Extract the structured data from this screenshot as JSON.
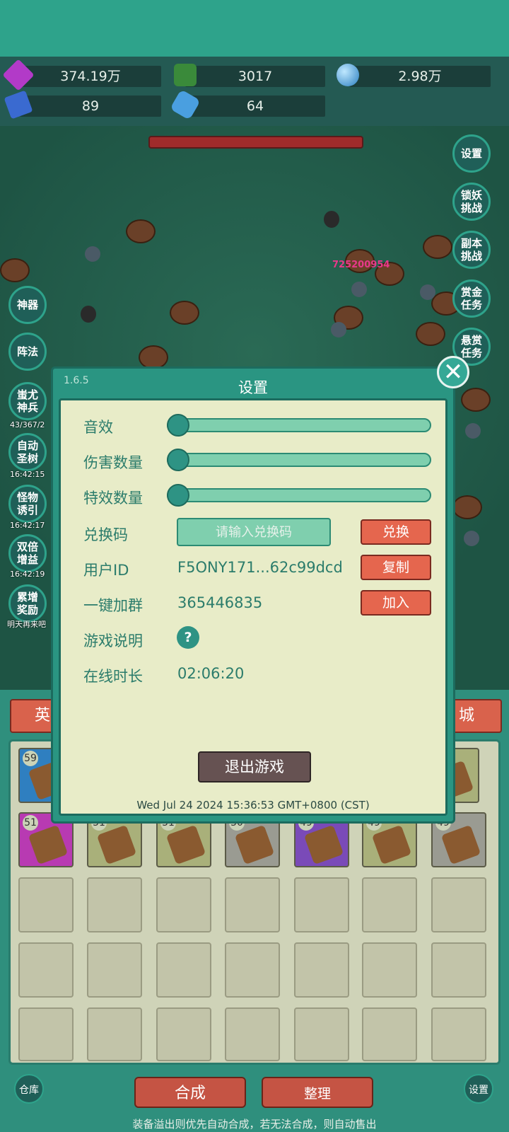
{
  "resources": [
    {
      "icon": "purple-gem-icon",
      "value": "374.19万"
    },
    {
      "icon": "green-gem-icon",
      "value": "3017"
    },
    {
      "icon": "blue-orb-icon",
      "value": "2.98万"
    },
    {
      "icon": "blue-book-icon",
      "value": "89"
    },
    {
      "icon": "blue-crystal-icon",
      "value": "64"
    }
  ],
  "right_buttons": [
    "设置",
    "锁妖挑战",
    "副本挑战",
    "赏金任务",
    "悬赏任务"
  ],
  "left_buttons": [
    {
      "label": "神器",
      "timer": ""
    },
    {
      "label": "阵法",
      "timer": ""
    },
    {
      "label": "蚩尤神兵",
      "timer": "43/367/2"
    },
    {
      "label": "自动圣树",
      "timer": "16:42:15"
    },
    {
      "label": "怪物诱引",
      "timer": "16:42:17"
    },
    {
      "label": "双倍增益",
      "timer": "16:42:19"
    },
    {
      "label": "累增奖励",
      "timer": "明天再来吧"
    }
  ],
  "damage_number": "725200954",
  "tabs": {
    "left": "英",
    "right": "城"
  },
  "inventory": {
    "row1_levels": [
      "59",
      "",
      "",
      "",
      "",
      "",
      ""
    ],
    "row2_levels": [
      "51",
      "51",
      "51",
      "50",
      "49",
      "49",
      "49"
    ]
  },
  "bottom": {
    "warehouse": "仓库",
    "merge": "合成",
    "sort": "整理",
    "settings": "设置",
    "tip": "装备溢出则优先自动合成，若无法合成，则自动售出"
  },
  "dialog": {
    "version": "1.6.5",
    "title": "设置",
    "rows": {
      "sound": "音效",
      "damage_count": "伤害数量",
      "effect_count": "特效数量",
      "redeem_code": "兑换码",
      "user_id": "用户ID",
      "join_group": "一键加群",
      "game_help": "游戏说明",
      "online_time": "在线时长"
    },
    "redeem_placeholder": "请输入兑换码",
    "redeem_button": "兑换",
    "user_id_value": "F5ONY171...62c99dcd",
    "copy_button": "复制",
    "group_number": "365446835",
    "join_button": "加入",
    "help_icon": "?",
    "online_time_value": "02:06:20",
    "exit_button": "退出游戏",
    "datetime": "Wed Jul 24 2024 15:36:53 GMT+0800 (CST)",
    "close_icon": "✕"
  }
}
